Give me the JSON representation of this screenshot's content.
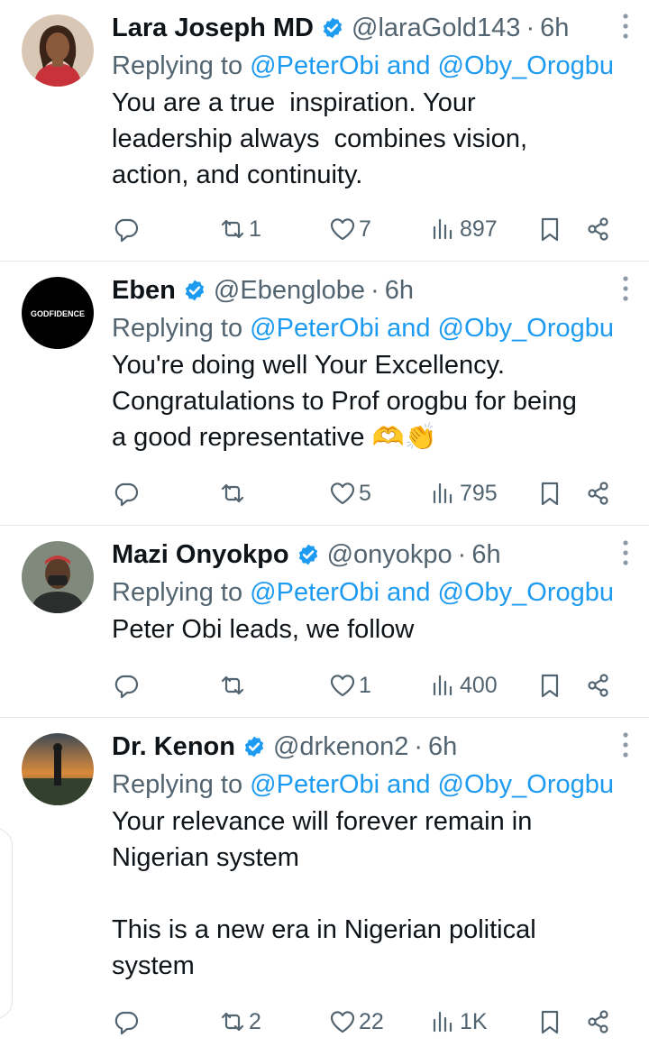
{
  "colors": {
    "link": "#1d9bf0",
    "muted": "#536471",
    "text": "#0f1419",
    "verified": "#1d9bf0"
  },
  "tweets": [
    {
      "name": "Lara Joseph MD",
      "handle": "@laraGold143",
      "time": "6h",
      "replying_prefix": "Replying to ",
      "replying_to": "@PeterObi and @Oby_Orogbu",
      "text": "You are a true  inspiration. Your\nleadership always  combines vision,\naction, and continuity.",
      "avatar_icon": "woman-portrait-avatar",
      "stats": {
        "replies": "",
        "retweets": "1",
        "likes": "7",
        "views": "897"
      }
    },
    {
      "name": "Eben",
      "handle": "@Ebenglobe",
      "time": "6h",
      "replying_prefix": "Replying to ",
      "replying_to": "@PeterObi and @Oby_Orogbu",
      "text": "You're doing well Your Excellency.\nCongratulations to Prof orogbu for being\na good representative 🫶👏",
      "avatar_text": "GODFIDENCE",
      "stats": {
        "replies": "",
        "retweets": "",
        "likes": "5",
        "views": "795"
      }
    },
    {
      "name": "Mazi Onyokpo",
      "handle": "@onyokpo",
      "time": "6h",
      "replying_prefix": "Replying to ",
      "replying_to": "@PeterObi and @Oby_Orogbu",
      "text": "Peter Obi leads, we follow",
      "avatar_icon": "man-with-mask-avatar",
      "stats": {
        "replies": "",
        "retweets": "",
        "likes": "1",
        "views": "400"
      }
    },
    {
      "name": "Dr. Kenon",
      "handle": "@drkenon2",
      "time": "6h",
      "replying_prefix": "Replying to ",
      "replying_to": "@PeterObi and @Oby_Orogbu",
      "text": "Your relevance will forever remain in\nNigerian system\n\nThis is a new era in Nigerian political\nsystem",
      "avatar_icon": "sunset-landscape-avatar",
      "stats": {
        "replies": "",
        "retweets": "2",
        "likes": "22",
        "views": "1K"
      }
    }
  ]
}
